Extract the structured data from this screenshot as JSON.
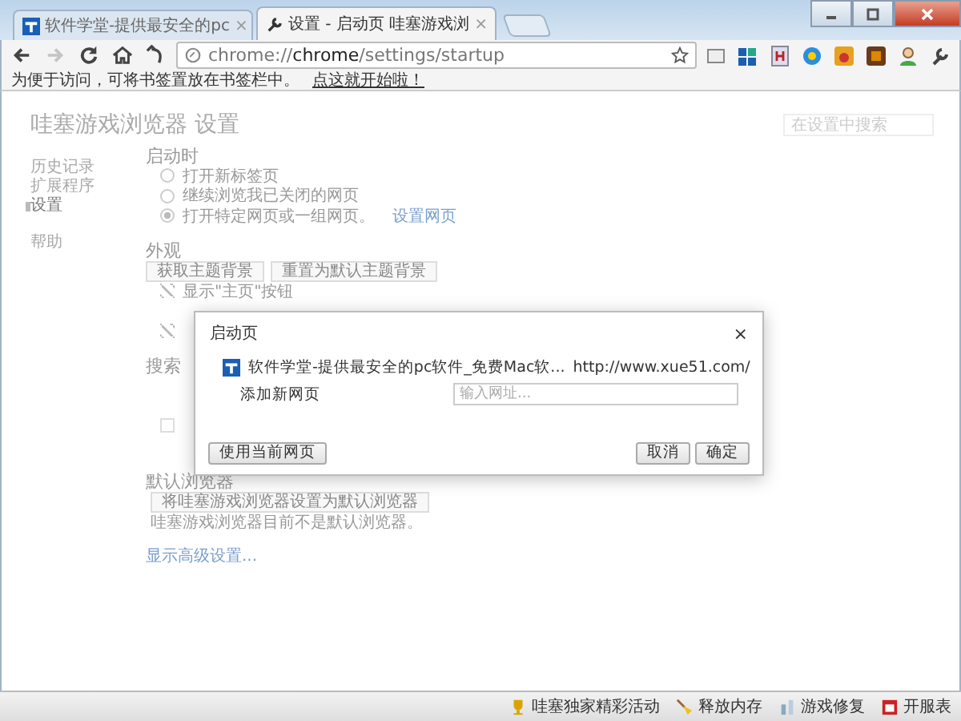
{
  "tabs": [
    {
      "title": "软件学堂-提供最安全的pc",
      "selected": false,
      "close": "×"
    },
    {
      "title": "设置 - 启动页 哇塞游戏浏",
      "selected": true,
      "close": "×"
    }
  ],
  "toolbar": {
    "back_disabled": false,
    "forward_disabled": true,
    "address": "chrome://**chrome**/settings/startup"
  },
  "bookmark_bar": {
    "text": "为便于访问，可将书签置放在书签栏中。",
    "link": "点这就开始啦！"
  },
  "settings": {
    "title": "哇塞游戏浏览器 设置",
    "search_placeholder": "在设置中搜索",
    "nav": [
      {
        "label": "历史记录",
        "selected": false
      },
      {
        "label": "扩展程序",
        "selected": false
      },
      {
        "label": "设置",
        "selected": true
      },
      {
        "label": "帮助",
        "selected": false
      }
    ],
    "startup": {
      "heading": "启动时",
      "options": [
        {
          "label": "打开新标签页",
          "selected": false
        },
        {
          "label": "继续浏览我已关闭的网页",
          "selected": false
        },
        {
          "label": "打开特定网页或一组网页。",
          "selected": true,
          "link": "设置网页"
        }
      ]
    },
    "appearance": {
      "heading": "外观",
      "buttons": [
        "获取主题背景",
        "重置为默认主题背景"
      ],
      "checkbox_1": {
        "label": "显示\"主页\"按钮",
        "checked": true
      },
      "checkbox_2": {
        "checked": true
      }
    },
    "search": {
      "heading": "搜索",
      "checkbox": {
        "checked": false
      }
    },
    "default_browser": {
      "heading": "默认浏览器",
      "button": "将哇塞游戏浏览器设置为默认浏览器",
      "note": "哇塞游戏浏览器目前不是默认浏览器。"
    },
    "advanced_link": "显示高级设置..."
  },
  "dialog": {
    "title": "启动页",
    "close": "×",
    "pages": [
      {
        "title": "软件学堂-提供最安全的pc软件_免费Mac软...",
        "url": "http://www.xue51.com/"
      }
    ],
    "add_label": "添加新网页",
    "add_placeholder": "输入网址...",
    "use_current": "使用当前网页",
    "cancel": "取消",
    "ok": "确定"
  },
  "status_bar": [
    {
      "label": "哇塞独家精彩活动"
    },
    {
      "label": "释放内存"
    },
    {
      "label": "游戏修复"
    },
    {
      "label": "开服表"
    }
  ]
}
